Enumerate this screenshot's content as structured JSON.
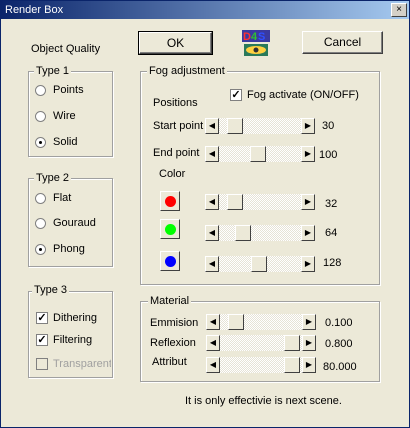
{
  "window": {
    "title": "Render Box",
    "close_glyph": "×"
  },
  "buttons": {
    "ok": "OK",
    "cancel": "Cancel"
  },
  "object_quality": "Object Quality",
  "logo_text": "D4S",
  "type1": {
    "title": "Type 1",
    "options": [
      "Points",
      "Wire",
      "Solid"
    ],
    "selected": "Solid"
  },
  "type2": {
    "title": "Type 2",
    "options": [
      "Flat",
      "Gouraud",
      "Phong"
    ],
    "selected": "Phong"
  },
  "type3": {
    "title": "Type 3",
    "dithering": "Dithering",
    "filtering": "Filtering",
    "transparent": "Transparent",
    "dithering_checked": true,
    "filtering_checked": true,
    "transparent_checked": false
  },
  "fog": {
    "title": "Fog adjustment",
    "positions": "Positions",
    "activate_label": "Fog activate (ON/OFF)",
    "activate_checked": true,
    "start_label": "Start point",
    "start_value": "30",
    "end_label": "End point",
    "end_value": "100",
    "color_label": "Color",
    "red_value": "32",
    "green_value": "64",
    "blue_value": "128"
  },
  "material": {
    "title": "Material",
    "emmision_label": "Emmision",
    "emmision_value": "0.100",
    "reflexion_label": "Reflexion",
    "reflexion_value": "0.800",
    "attribut_label": "Attribut",
    "attribut_value": "80.000"
  },
  "footer_note": "It is only effectivie is next scene.",
  "colors": {
    "red": "#ff0000",
    "green": "#00ff00",
    "blue": "#0000ff"
  },
  "icons": {
    "close": "close-icon",
    "left": "arrow-left-icon",
    "right": "arrow-right-icon"
  }
}
